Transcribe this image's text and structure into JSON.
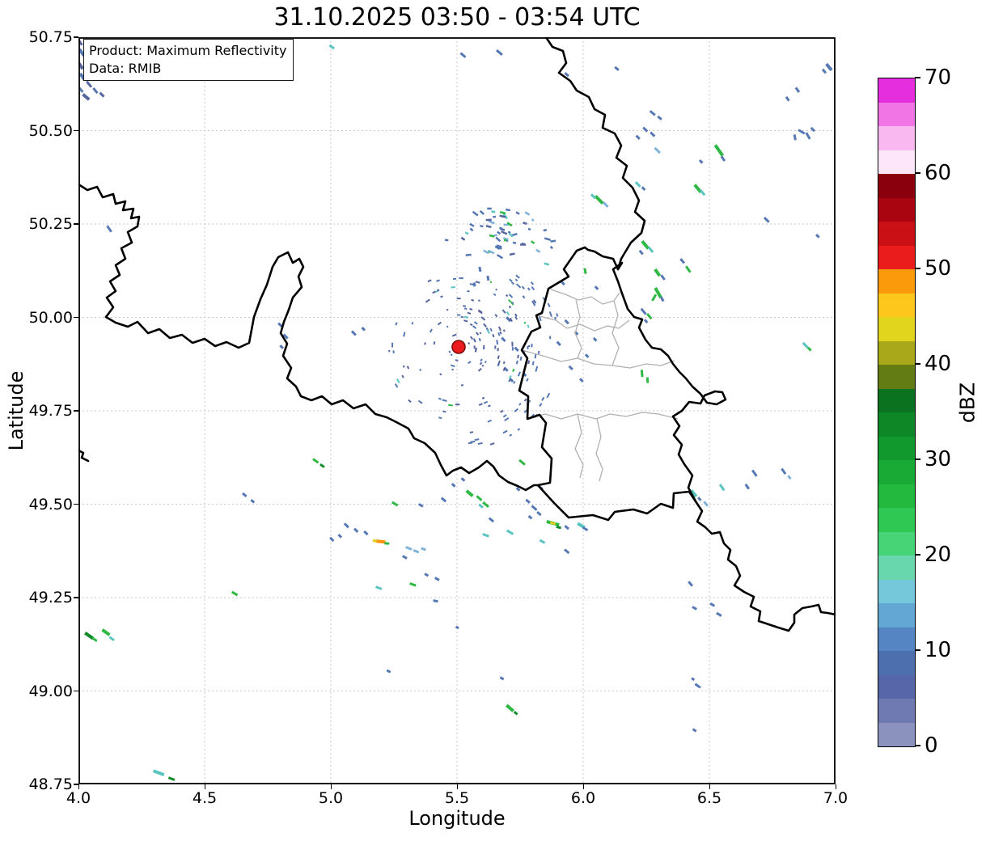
{
  "title": "31.10.2025 03:50 - 03:54 UTC",
  "annotation_box": {
    "line1": "Product: Maximum Reflectivity",
    "line2": "Data: RMIB"
  },
  "axes": {
    "xlabel": "Longitude",
    "ylabel": "Latitude",
    "x_range": [
      4.0,
      7.0
    ],
    "y_range": [
      48.75,
      50.75
    ],
    "x_ticks": [
      {
        "v": 4.0,
        "label": "4.0"
      },
      {
        "v": 4.5,
        "label": "4.5"
      },
      {
        "v": 5.0,
        "label": "5.0"
      },
      {
        "v": 5.5,
        "label": "5.5"
      },
      {
        "v": 6.0,
        "label": "6.0"
      },
      {
        "v": 6.5,
        "label": "6.5"
      },
      {
        "v": 7.0,
        "label": "7.0"
      }
    ],
    "y_ticks": [
      {
        "v": 50.75,
        "label": "50.75"
      },
      {
        "v": 50.5,
        "label": "50.50"
      },
      {
        "v": 50.25,
        "label": "50.25"
      },
      {
        "v": 50.0,
        "label": "50.00"
      },
      {
        "v": 49.75,
        "label": "49.75"
      },
      {
        "v": 49.5,
        "label": "49.50"
      },
      {
        "v": 49.25,
        "label": "49.25"
      },
      {
        "v": 49.0,
        "label": "49.00"
      },
      {
        "v": 48.75,
        "label": "48.75"
      }
    ],
    "grid_style": "dashed",
    "grid_color": "#c9c9c9"
  },
  "colorbar": {
    "label": "dBZ",
    "min": 0,
    "max": 70,
    "step": 2.5,
    "ticks": [
      {
        "v": 70,
        "label": "70"
      },
      {
        "v": 60,
        "label": "60"
      },
      {
        "v": 50,
        "label": "50"
      },
      {
        "v": 40,
        "label": "40"
      },
      {
        "v": 30,
        "label": "30"
      },
      {
        "v": 20,
        "label": "20"
      },
      {
        "v": 10,
        "label": "10"
      },
      {
        "v": 0,
        "label": "0"
      }
    ],
    "colors_bottom_to_top": [
      "#8a92bd",
      "#6f7ab2",
      "#5766a9",
      "#4e6fae",
      "#5585c2",
      "#63a8d5",
      "#74c8da",
      "#68d7ae",
      "#47d477",
      "#2fc852",
      "#22b93e",
      "#18aa34",
      "#12992e",
      "#0e8727",
      "#0b731f",
      "#637c13",
      "#a8a81a",
      "#e2d51e",
      "#fdc71b",
      "#fb9a0b",
      "#ea1d1c",
      "#cb1015",
      "#a90511",
      "#8a000d",
      "#fde6f9",
      "#f9b8f0",
      "#f175e5",
      "#e52edd"
    ]
  },
  "radar_site": {
    "lon": 5.508,
    "lat": 49.921,
    "fill": "#ec1b1e",
    "edge": "#7a0d0d"
  },
  "map_style": {
    "country_border_color": "#000000",
    "canton_border_color": "#b0b0b0"
  },
  "echo_colors": {
    "b": "#5578b4",
    "b2": "#56659f",
    "lb": "#7fb2d9",
    "c": "#5ac5c0",
    "g": "#2fb944",
    "dg": "#138a2b",
    "y": "#ddd01a",
    "o": "#fb9410"
  },
  "clutter_ring": {
    "center": [
      5.508,
      49.921
    ],
    "r_inner": 12,
    "r_outer": 92,
    "n": 230,
    "seed": 11,
    "outer_arc": {
      "r1": 92,
      "r2": 128,
      "a1": -55,
      "a2": 85,
      "n": 48
    }
  },
  "speckle_cluster": {
    "center": [
      5.668,
      50.215
    ],
    "dx": 47,
    "dy": 26,
    "n": 58,
    "seed": 5
  },
  "echoes": [
    [
      4.006,
      50.737,
      "b2",
      9,
      55
    ],
    [
      4.013,
      50.709,
      "b",
      10,
      55
    ],
    [
      4.006,
      50.676,
      "b2",
      12,
      55
    ],
    [
      4.016,
      50.644,
      "b",
      10,
      55
    ],
    [
      4.042,
      50.624,
      "b2",
      9,
      50
    ],
    [
      4.067,
      50.607,
      "b",
      8,
      50
    ],
    [
      4.01,
      50.609,
      "b",
      7,
      50
    ],
    [
      4.093,
      50.596,
      "b2",
      7,
      45
    ],
    [
      4.03,
      50.59,
      "b2",
      10,
      40
    ],
    [
      5.004,
      50.724,
      "c",
      7,
      35
    ],
    [
      5.524,
      50.702,
      "b",
      8,
      40
    ],
    [
      5.668,
      50.709,
      "b",
      9,
      40
    ],
    [
      6.133,
      50.666,
      "b",
      6,
      40
    ],
    [
      5.935,
      50.65,
      "b",
      6,
      40
    ],
    [
      6.974,
      50.67,
      "b",
      10,
      50
    ],
    [
      6.955,
      50.659,
      "b",
      6,
      50
    ],
    [
      6.849,
      50.609,
      "b",
      7,
      55
    ],
    [
      6.81,
      50.585,
      "b",
      6,
      55
    ],
    [
      6.865,
      50.497,
      "b",
      9,
      30
    ],
    [
      6.891,
      50.486,
      "b",
      9,
      60
    ],
    [
      6.839,
      50.482,
      "b",
      7,
      80
    ],
    [
      6.91,
      50.503,
      "b",
      6,
      45
    ],
    [
      6.538,
      50.447,
      "g",
      16,
      55
    ],
    [
      6.554,
      50.425,
      "b",
      7,
      55
    ],
    [
      6.467,
      50.417,
      "b",
      5,
      45
    ],
    [
      6.727,
      50.261,
      "b",
      8,
      45
    ],
    [
      6.454,
      50.345,
      "g",
      12,
      50
    ],
    [
      6.473,
      50.334,
      "c",
      8,
      50
    ],
    [
      6.063,
      50.315,
      "g",
      13,
      45
    ],
    [
      6.089,
      50.302,
      "lb",
      8,
      45
    ],
    [
      6.04,
      50.324,
      "c",
      7,
      45
    ],
    [
      6.929,
      50.218,
      "b",
      5,
      45
    ],
    [
      6.275,
      50.547,
      "b",
      8,
      40
    ],
    [
      6.303,
      50.534,
      "b",
      6,
      40
    ],
    [
      6.246,
      50.503,
      "b",
      7,
      45
    ],
    [
      6.275,
      50.49,
      "b",
      7,
      45
    ],
    [
      6.217,
      50.482,
      "b",
      6,
      45
    ],
    [
      6.294,
      50.447,
      "lb",
      9,
      45
    ],
    [
      6.217,
      50.356,
      "c",
      8,
      45
    ],
    [
      6.239,
      50.345,
      "b",
      5,
      45
    ],
    [
      6.246,
      50.194,
      "g",
      12,
      50
    ],
    [
      6.268,
      50.181,
      "c",
      8,
      50
    ],
    [
      6.23,
      50.174,
      "b",
      6,
      50
    ],
    [
      6.294,
      50.12,
      "g",
      10,
      55
    ],
    [
      6.316,
      50.107,
      "b",
      7,
      55
    ],
    [
      6.393,
      50.151,
      "b",
      7,
      50
    ],
    [
      6.416,
      50.129,
      "g",
      9,
      55
    ],
    [
      6.297,
      50.066,
      "g",
      14,
      60
    ],
    [
      6.281,
      50.053,
      "g",
      9,
      120
    ],
    [
      6.313,
      50.049,
      "b",
      6,
      60
    ],
    [
      6.239,
      50.016,
      "b",
      9,
      50
    ],
    [
      6.262,
      50.003,
      "g",
      8,
      50
    ],
    [
      6.249,
      49.99,
      "b",
      5,
      50
    ],
    [
      5.919,
      50.092,
      "b",
      6,
      45
    ],
    [
      6.008,
      50.124,
      "g",
      7,
      80
    ],
    [
      6.053,
      50.079,
      "b",
      5,
      45
    ],
    [
      5.935,
      49.988,
      "b",
      6,
      45
    ],
    [
      5.973,
      49.958,
      "b",
      5,
      45
    ],
    [
      5.903,
      49.93,
      "b",
      6,
      45
    ],
    [
      6.015,
      49.897,
      "b",
      5,
      45
    ],
    [
      5.951,
      49.865,
      "b",
      6,
      45
    ],
    [
      6.047,
      49.941,
      "b",
      5,
      45
    ],
    [
      5.993,
      49.832,
      "b",
      5,
      45
    ],
    [
      6.233,
      49.85,
      "g",
      9,
      85
    ],
    [
      6.255,
      49.832,
      "g",
      7,
      85
    ],
    [
      5.704,
      49.995,
      "b",
      7,
      45
    ],
    [
      5.684,
      49.941,
      "b",
      6,
      45
    ],
    [
      5.736,
      49.915,
      "b",
      6,
      45
    ],
    [
      5.694,
      49.861,
      "b",
      6,
      45
    ],
    [
      5.716,
      49.832,
      "b",
      5,
      45
    ],
    [
      5.768,
      49.847,
      "b",
      5,
      45
    ],
    [
      5.591,
      50.129,
      "b",
      6,
      80
    ],
    [
      5.623,
      50.105,
      "b",
      6,
      80
    ],
    [
      5.569,
      50.088,
      "b",
      5,
      80
    ],
    [
      5.091,
      49.958,
      "b",
      7,
      45
    ],
    [
      5.129,
      49.969,
      "b",
      5,
      45
    ],
    [
      4.799,
      49.98,
      "b",
      6,
      45
    ],
    [
      4.821,
      49.949,
      "b",
      7,
      45
    ],
    [
      4.805,
      49.921,
      "b",
      5,
      45
    ],
    [
      4.122,
      50.237,
      "b",
      9,
      55
    ],
    [
      5.55,
      49.529,
      "g",
      10,
      40
    ],
    [
      5.588,
      49.516,
      "g",
      8,
      40
    ],
    [
      5.614,
      49.499,
      "g",
      9,
      40
    ],
    [
      5.595,
      49.495,
      "c",
      6,
      40
    ],
    [
      5.758,
      49.612,
      "g",
      9,
      40
    ],
    [
      5.88,
      49.449,
      "g",
      16,
      15
    ],
    [
      5.88,
      49.449,
      "y",
      7,
      15
    ],
    [
      5.903,
      49.438,
      "dg",
      6,
      15
    ],
    [
      5.71,
      49.425,
      "c",
      9,
      30
    ],
    [
      5.614,
      49.417,
      "c",
      8,
      20
    ],
    [
      5.838,
      49.4,
      "c",
      7,
      30
    ],
    [
      5.992,
      49.443,
      "c",
      10,
      30
    ],
    [
      6.008,
      49.434,
      "b",
      7,
      30
    ],
    [
      5.447,
      49.512,
      "b",
      7,
      40
    ],
    [
      5.636,
      49.458,
      "b",
      7,
      40
    ],
    [
      5.781,
      49.508,
      "b",
      6,
      40
    ],
    [
      5.806,
      49.49,
      "b",
      8,
      40
    ],
    [
      5.825,
      49.475,
      "b",
      6,
      40
    ],
    [
      5.79,
      49.465,
      "b",
      5,
      40
    ],
    [
      5.742,
      49.54,
      "b",
      5,
      40
    ],
    [
      5.832,
      49.544,
      "b",
      6,
      40
    ],
    [
      5.935,
      49.438,
      "b",
      6,
      40
    ],
    [
      5.935,
      49.374,
      "b",
      7,
      40
    ],
    [
      5.486,
      49.551,
      "b",
      5,
      40
    ],
    [
      5.524,
      49.566,
      "b",
      5,
      40
    ],
    [
      5.197,
      49.4,
      "o",
      12,
      5
    ],
    [
      5.174,
      49.402,
      "y",
      5,
      5
    ],
    [
      5.222,
      49.395,
      "g",
      6,
      5
    ],
    [
      5.254,
      49.501,
      "g",
      8,
      30
    ],
    [
      5.357,
      49.497,
      "b",
      6,
      30
    ],
    [
      5.062,
      49.443,
      "b",
      7,
      45
    ],
    [
      5.1,
      49.43,
      "b",
      6,
      45
    ],
    [
      5.139,
      49.423,
      "b",
      6,
      45
    ],
    [
      5.036,
      49.415,
      "b",
      5,
      45
    ],
    [
      5.004,
      49.406,
      "b",
      6,
      45
    ],
    [
      5.309,
      49.382,
      "lb",
      8,
      20
    ],
    [
      5.338,
      49.374,
      "lb",
      7,
      20
    ],
    [
      5.367,
      49.38,
      "lb",
      6,
      20
    ],
    [
      5.293,
      49.358,
      "b",
      6,
      30
    ],
    [
      5.379,
      49.311,
      "b",
      5,
      30
    ],
    [
      5.421,
      49.3,
      "b",
      6,
      30
    ],
    [
      5.325,
      49.285,
      "g",
      8,
      20
    ],
    [
      5.19,
      49.276,
      "c",
      8,
      20
    ],
    [
      5.415,
      49.241,
      "b",
      6,
      10
    ],
    [
      5.501,
      49.17,
      "b",
      4,
      30
    ],
    [
      5.229,
      49.053,
      "b",
      5,
      30
    ],
    [
      5.678,
      49.034,
      "b",
      5,
      30
    ],
    [
      6.679,
      49.583,
      "b",
      9,
      55
    ],
    [
      6.794,
      49.588,
      "b",
      8,
      55
    ],
    [
      6.817,
      49.572,
      "lb",
      5,
      55
    ],
    [
      6.65,
      49.547,
      "b",
      7,
      55
    ],
    [
      6.55,
      49.545,
      "c",
      9,
      55
    ],
    [
      6.438,
      49.529,
      "c",
      10,
      50
    ],
    [
      6.461,
      49.514,
      "b",
      5,
      50
    ],
    [
      6.486,
      49.501,
      "lb",
      7,
      50
    ],
    [
      6.881,
      49.925,
      "c",
      9,
      45
    ],
    [
      6.897,
      49.915,
      "g",
      5,
      45
    ],
    [
      6.425,
      49.287,
      "b",
      7,
      50
    ],
    [
      6.512,
      49.231,
      "b",
      6,
      30
    ],
    [
      6.538,
      49.205,
      "b",
      7,
      30
    ],
    [
      6.441,
      49.222,
      "b",
      6,
      30
    ],
    [
      6.454,
      49.014,
      "b",
      8,
      35
    ],
    [
      6.435,
      49.032,
      "b",
      4,
      35
    ],
    [
      6.441,
      48.895,
      "b",
      5,
      35
    ],
    [
      4.042,
      49.148,
      "dg",
      12,
      35
    ],
    [
      4.064,
      49.138,
      "g",
      7,
      35
    ],
    [
      4.109,
      49.157,
      "g",
      11,
      35
    ],
    [
      4.132,
      49.14,
      "c",
      7,
      35
    ],
    [
      4.619,
      49.261,
      "g",
      8,
      30
    ],
    [
      4.94,
      49.616,
      "g",
      8,
      35
    ],
    [
      4.966,
      49.603,
      "dg",
      6,
      35
    ],
    [
      4.318,
      48.781,
      "c",
      14,
      20
    ],
    [
      4.369,
      48.765,
      "dg",
      8,
      20
    ],
    [
      4.658,
      49.525,
      "b",
      6,
      40
    ],
    [
      4.69,
      49.508,
      "b",
      5,
      40
    ],
    [
      5.71,
      48.954,
      "g",
      11,
      40
    ],
    [
      5.733,
      48.941,
      "dg",
      5,
      40
    ]
  ]
}
